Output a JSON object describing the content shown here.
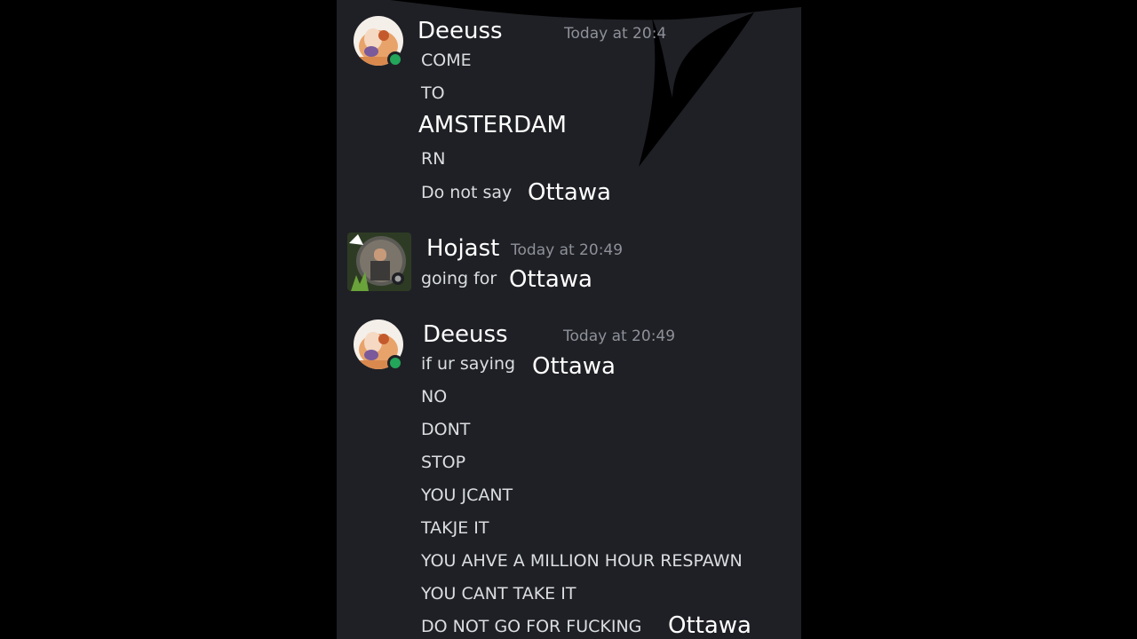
{
  "colors": {
    "background": "#000000",
    "chat_bg": "#1f2025",
    "username": "#ffffff",
    "timestamp": "#8e9199",
    "message_text": "#dbdee1",
    "online_status": "#23a55a"
  },
  "messages": [
    {
      "author": "Deeuss",
      "timestamp": "Today at 20:4",
      "avatar_icon": "anime-avatar-icon",
      "online": true,
      "lines": [
        {
          "text": "COME"
        },
        {
          "text": "TO"
        },
        {
          "text": "AMSTERDAM"
        },
        {
          "text": "RN"
        },
        {
          "text": "Do not say",
          "emphasis": "Ottawa"
        }
      ]
    },
    {
      "author": "Hojast",
      "timestamp": "Today at 20:49",
      "avatar_icon": "photo-avatar-icon",
      "online": false,
      "lines": [
        {
          "text": "going for",
          "emphasis": "Ottawa"
        }
      ]
    },
    {
      "author": "Deeuss",
      "timestamp": "Today at 20:49",
      "avatar_icon": "anime-avatar-icon",
      "online": true,
      "lines": [
        {
          "text": "if ur saying",
          "emphasis": "Ottawa"
        },
        {
          "text": "NO"
        },
        {
          "text": "DONT"
        },
        {
          "text": "STOP"
        },
        {
          "text": "YOU JCANT"
        },
        {
          "text": "TAKJE IT"
        },
        {
          "text": "YOU AHVE A MILLION HOUR RESPAWN"
        },
        {
          "text": "YOU CANT TAKE IT"
        },
        {
          "text": "DO NOT GO FOR FUCKING",
          "emphasis": "Ottawa"
        }
      ]
    }
  ]
}
